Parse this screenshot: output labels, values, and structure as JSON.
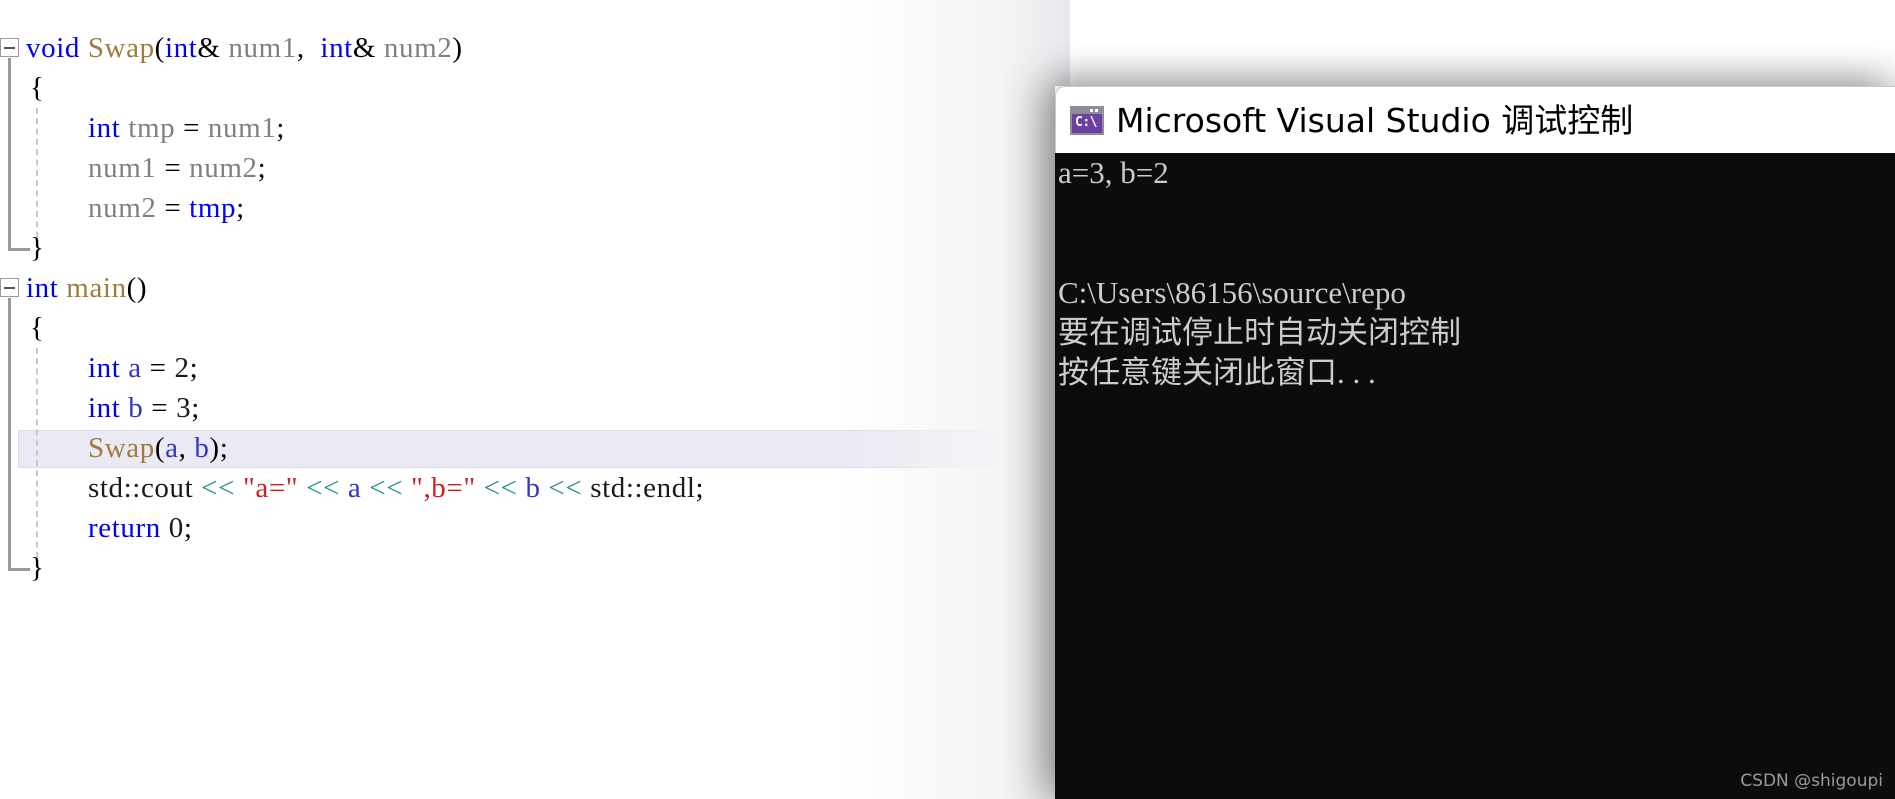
{
  "editor": {
    "name": "visual-studio-code-editor",
    "background": "#ffffff",
    "highlighted_line_index": 9,
    "colors": {
      "keyword": "#0000ff",
      "function": "#a07b3e",
      "identifier": "#808080",
      "variable": "#3434c8",
      "string": "#cc2222",
      "operator": "#2a8a8a",
      "plain": "#1a1a1a",
      "current_line_background": "#e9eaf4",
      "fold_marker": "#9a9a9a",
      "indent_guide": "#c8c8c8"
    },
    "lines": [
      {
        "indent": 0,
        "text": "void Swap(int& num1, int& num2)"
      },
      {
        "indent": 0,
        "text": "{"
      },
      {
        "indent": 1,
        "text": "int tmp = num1;"
      },
      {
        "indent": 1,
        "text": "num1 = num2;"
      },
      {
        "indent": 1,
        "text": "num2 = tmp;"
      },
      {
        "indent": 0,
        "text": "}"
      },
      {
        "indent": 0,
        "text": "int main()"
      },
      {
        "indent": 0,
        "text": "{"
      },
      {
        "indent": 1,
        "text": "int a = 2;"
      },
      {
        "indent": 1,
        "text": "int b = 3;"
      },
      {
        "indent": 1,
        "text": "Swap(a, b);"
      },
      {
        "indent": 1,
        "text": "std::cout << \"a=\" << a << \",b=\" << b << std::endl;"
      },
      {
        "indent": 1,
        "text": "return 0;"
      },
      {
        "indent": 0,
        "text": "}"
      }
    ]
  },
  "console": {
    "window_name": "microsoft-visual-studio-debug-console",
    "title": "Microsoft Visual Studio 调试控制",
    "icon_name": "command-prompt-icon",
    "icon_glyph": "C:\\",
    "icon_color": "#6a3fa0",
    "background": "#0c0c0c",
    "text_color": "#cccccc",
    "lines": [
      "a=3, b=2",
      "",
      "",
      "C:\\Users\\86156\\source\\repo",
      "要在调试停止时自动关闭控制",
      "按任意键关闭此窗口. . ."
    ]
  },
  "watermark": {
    "text": "CSDN @shigoupi"
  }
}
